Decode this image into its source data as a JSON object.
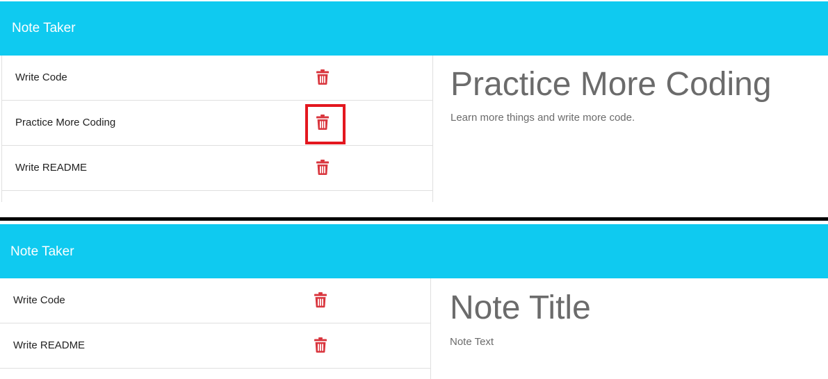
{
  "colors": {
    "navbar": "#0fcaf0",
    "trash": "#d9363e",
    "highlight": "#e3171f",
    "divider": "#000000"
  },
  "top_panel": {
    "brand": "Note Taker",
    "notes": [
      {
        "title": "Write Code",
        "icon": "trash-icon"
      },
      {
        "title": "Practice More Coding",
        "icon": "trash-icon",
        "highlighted": true
      },
      {
        "title": "Write README",
        "icon": "trash-icon"
      }
    ],
    "active_note": {
      "title": "Practice More Coding",
      "text": "Learn more things and write more code."
    }
  },
  "bottom_panel": {
    "brand": "Note Taker",
    "notes": [
      {
        "title": "Write Code",
        "icon": "trash-icon"
      },
      {
        "title": "Write README",
        "icon": "trash-icon"
      }
    ],
    "editor": {
      "title_placeholder": "Note Title",
      "text_placeholder": "Note Text"
    }
  }
}
